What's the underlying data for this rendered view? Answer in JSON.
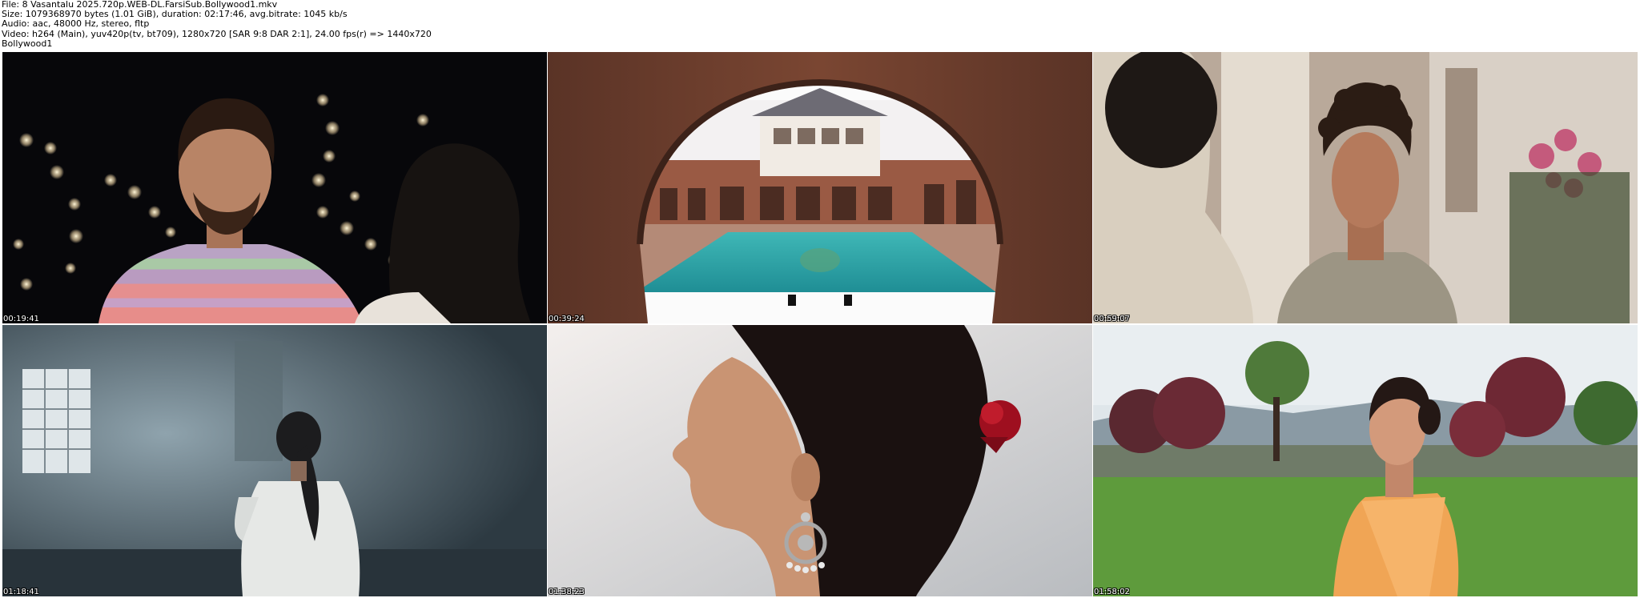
{
  "header": {
    "file": "File: 8 Vasantalu 2025.720p.WEB-DL.FarsiSub.Bollywood1.mkv",
    "size": "Size: 1079368970 bytes (1.01 GiB), duration: 02:17:46, avg.bitrate: 1045 kb/s",
    "audio": "Audio: aac, 48000 Hz, stereo, fltp",
    "video": "Video: h264 (Main), yuv420p(tv, bt709), 1280x720 [SAR 9:8 DAR 2:1], 24.00 fps(r) => 1440x720",
    "tag": "Bollywood1"
  },
  "thumbnails": [
    {
      "timestamp": "00:19:41",
      "scene": "man in striped polo at night with bokeh lights"
    },
    {
      "timestamp": "00:39:24",
      "scene": "villa courtyard with swimming pool through brick arch"
    },
    {
      "timestamp": "00:59:07",
      "scene": "young man with curly hair in grey shirt outdoors"
    },
    {
      "timestamp": "01:18:41",
      "scene": "woman in white shirt in dim hazy room"
    },
    {
      "timestamp": "01:38:23",
      "scene": "woman profile with red rose in hair and earring"
    },
    {
      "timestamp": "01:58:02",
      "scene": "smiling woman in orange saree in garden"
    }
  ]
}
